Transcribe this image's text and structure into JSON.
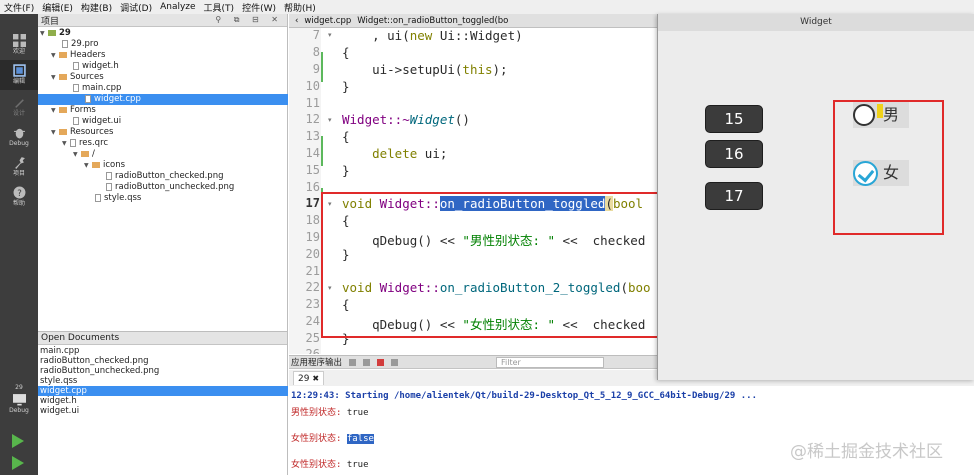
{
  "menu": [
    "文件(F)",
    "编辑(E)",
    "构建(B)",
    "调试(D)",
    "Analyze",
    "工具(T)",
    "控件(W)",
    "帮助(H)"
  ],
  "modes": [
    {
      "label": "欢迎",
      "icon": "grid-icon"
    },
    {
      "label": "编辑",
      "icon": "edit-icon"
    },
    {
      "label": "设计",
      "icon": "pen-icon"
    },
    {
      "label": "Debug",
      "icon": "bug-icon"
    },
    {
      "label": "项目",
      "icon": "wrench-icon"
    },
    {
      "label": "帮助",
      "icon": "help-icon"
    }
  ],
  "kit": {
    "name": "29",
    "label": "Debug"
  },
  "project": {
    "title": "项目",
    "tree": [
      {
        "text": "29",
        "type": "project"
      },
      {
        "text": "29.pro",
        "type": "file"
      },
      {
        "text": "Headers",
        "type": "folder"
      },
      {
        "text": "widget.h",
        "type": "file"
      },
      {
        "text": "Sources",
        "type": "folder"
      },
      {
        "text": "main.cpp",
        "type": "file"
      },
      {
        "text": "widget.cpp",
        "type": "file",
        "selected": true
      },
      {
        "text": "Forms",
        "type": "folder"
      },
      {
        "text": "widget.ui",
        "type": "file"
      },
      {
        "text": "Resources",
        "type": "folder"
      },
      {
        "text": "res.qrc",
        "type": "file"
      },
      {
        "text": "/",
        "type": "folder"
      },
      {
        "text": "icons",
        "type": "folder"
      },
      {
        "text": "radioButton_checked.png",
        "type": "file"
      },
      {
        "text": "radioButton_unchecked.png",
        "type": "file"
      },
      {
        "text": "style.qss",
        "type": "file"
      }
    ]
  },
  "open_documents": {
    "title": "Open Documents",
    "items": [
      "main.cpp",
      "radioButton_checked.png",
      "radioButton_unchecked.png",
      "style.qss",
      "widget.cpp",
      "widget.h",
      "widget.ui"
    ],
    "selected_index": 4
  },
  "editor": {
    "file_tab": "widget.cpp",
    "symbol_tab": "Widget::on_radioButton_toggled(bo",
    "line_numbers": [
      "7",
      "8",
      "9",
      "10",
      "11",
      "12",
      "13",
      "14",
      "15",
      "16",
      "17",
      "18",
      "19",
      "20",
      "21",
      "22",
      "23",
      "24",
      "25",
      "26"
    ],
    "current_line": "17",
    "lines": [
      {
        "a": "    , ui(",
        "b": "new",
        "c": " Ui::Widget)"
      },
      {
        "a": "{"
      },
      {
        "a": "    ui->setupUi(",
        "b": "this",
        "c": ");"
      },
      {
        "a": "}"
      },
      {
        "a": ""
      },
      {
        "a": "Widget::~",
        "b": "Widget",
        "c": "()"
      },
      {
        "a": "{"
      },
      {
        "a": "    ",
        "b": "delete",
        "c": " ui;"
      },
      {
        "a": "}"
      },
      {
        "a": ""
      },
      {
        "a": "void",
        "b": " Widget::",
        "c": "on_radioButton_toggled",
        "d": "(",
        "e": "bool"
      },
      {
        "a": "{"
      },
      {
        "a": "    qDebug() << ",
        "b": "\"男性别状态: \"",
        "c": " <<  checked"
      },
      {
        "a": "}"
      },
      {
        "a": ""
      },
      {
        "a": "void",
        "b": " Widget::",
        "c": "on_radioButton_2_toggled",
        "d": "(",
        "e": "boo"
      },
      {
        "a": "{"
      },
      {
        "a": "    qDebug() << ",
        "b": "\"女性别状态: \"",
        "c": " <<  checked"
      },
      {
        "a": "}"
      },
      {
        "a": ""
      }
    ]
  },
  "output": {
    "title": "应用程序输出",
    "filter_placeholder": "Filter",
    "tab_label": "29",
    "tab_close": "✖",
    "start_line": "12:29:43: Starting /home/alientek/Qt/build-29-Desktop_Qt_5_12_9_GCC_64bit-Debug/29 ...",
    "lines": [
      {
        "label": "男性别状态: ",
        "value": "true",
        "selected": false
      },
      {
        "label": "女性别状态: ",
        "value": "false",
        "selected": true
      },
      {
        "label": "女性别状态: ",
        "value": "true",
        "selected": false
      }
    ]
  },
  "widget_window": {
    "title": "Widget",
    "buttons": [
      "15",
      "16",
      "17"
    ],
    "radios": [
      {
        "label": "男",
        "checked": false
      },
      {
        "label": "女",
        "checked": true
      }
    ]
  },
  "watermark": "@稀土掘金技术社区",
  "colors": {
    "annotation_red": "#e02a2a",
    "selection_blue": "#3b8ff0",
    "check_blue": "#29a6d6"
  }
}
